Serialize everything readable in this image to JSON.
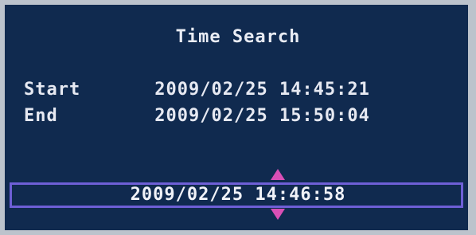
{
  "dialog": {
    "title": "Time Search",
    "start": {
      "label": "Start",
      "value": "2009/02/25 14:45:21"
    },
    "end": {
      "label": "End",
      "value": "2009/02/25 15:50:04"
    },
    "cursor": {
      "value": "2009/02/25 14:46:58"
    }
  },
  "icons": {
    "up": "arrow-up-icon",
    "down": "arrow-down-icon"
  },
  "colors": {
    "background": "#102a4f",
    "text": "#e6e9f2",
    "cursor_border": "#6e5fd6",
    "arrow": "#d94fb6"
  }
}
